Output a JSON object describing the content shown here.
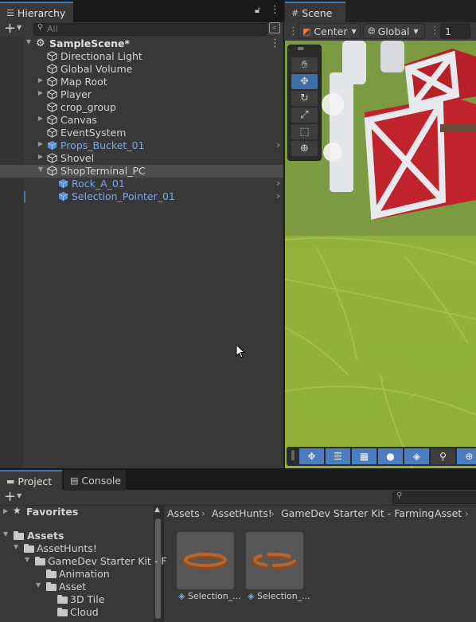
{
  "hierarchy": {
    "tab_label": "Hierarchy",
    "search_placeholder": "All",
    "scene_name": "SampleScene*",
    "items": [
      {
        "label": "Directional Light",
        "prefab": false,
        "arrow": false
      },
      {
        "label": "Global Volume",
        "prefab": false,
        "arrow": false
      },
      {
        "label": "Map Root",
        "prefab": false,
        "arrow": true
      },
      {
        "label": "Player",
        "prefab": false,
        "arrow": true
      },
      {
        "label": "crop_group",
        "prefab": false,
        "arrow": false
      },
      {
        "label": "Canvas",
        "prefab": false,
        "arrow": true
      },
      {
        "label": "EventSystem",
        "prefab": false,
        "arrow": false
      },
      {
        "label": "Props_Bucket_01",
        "prefab": true,
        "arrow": true
      },
      {
        "label": "Shovel",
        "prefab": false,
        "arrow": true
      },
      {
        "label": "ShopTerminal_PC",
        "prefab": false,
        "arrow": "open"
      },
      {
        "label": "Rock_A_01",
        "prefab": true,
        "arrow": false
      },
      {
        "label": "Selection_Pointer_01",
        "prefab": true,
        "arrow": false
      }
    ]
  },
  "scene": {
    "tab_label": "Scene",
    "pivot_label": "Center",
    "space_label": "Global",
    "grid_value": "1"
  },
  "project": {
    "tab_label": "Project",
    "console_label": "Console",
    "favorites_label": "Favorites",
    "tree": [
      {
        "label": "Assets",
        "depth": 0
      },
      {
        "label": "AssetHunts!",
        "depth": 1
      },
      {
        "label": "GameDev Starter Kit - F",
        "depth": 2
      },
      {
        "label": "Animation",
        "depth": 3
      },
      {
        "label": "Asset",
        "depth": 3
      },
      {
        "label": "3D Tile",
        "depth": 4
      },
      {
        "label": "Cloud",
        "depth": 4
      }
    ],
    "breadcrumb": [
      "Assets",
      "AssetHunts!",
      "GameDev Starter Kit - Farming",
      "Asset"
    ],
    "assets": [
      {
        "label": "Selection_..."
      },
      {
        "label": "Selection_..."
      }
    ]
  },
  "colors": {
    "accent": "#3a79bb",
    "prefab_text": "#7ca6e8",
    "barn_red": "#c0232b",
    "grass": "#93b33a"
  }
}
